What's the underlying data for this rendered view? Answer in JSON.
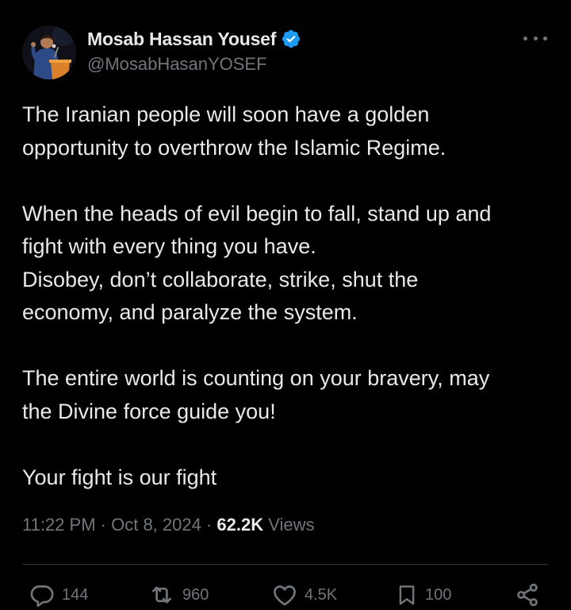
{
  "author": {
    "display_name": "Mosab Hassan Yousef",
    "handle": "@MosabHasanYOSEF",
    "verified": true,
    "avatar_icon": "speaker-at-podium-avatar"
  },
  "tweet": {
    "paragraphs": [
      [
        "The Iranian people will soon have a golden",
        "opportunity to overthrow the Islamic Regime."
      ],
      [
        "When the heads of evil begin to fall, stand up and",
        "fight with every thing you have.",
        "Disobey, don’t collaborate, strike, shut the",
        "economy, and paralyze the system."
      ],
      [
        "The entire world is counting on your bravery, may",
        "the Divine force guide you!"
      ],
      [
        "Your fight is our fight"
      ]
    ]
  },
  "meta": {
    "time": "11:22 PM",
    "separator": " · ",
    "date": "Oct 8, 2024",
    "views_count": "62.2K",
    "views_label": " Views"
  },
  "actions": {
    "replies": "144",
    "reposts": "960",
    "likes": "4.5K",
    "bookmarks": "100"
  },
  "colors": {
    "background": "#000000",
    "text_primary": "#e7e9ea",
    "text_secondary": "#71767b",
    "verified_blue": "#1d9bf0",
    "divider": "#2f3336"
  }
}
